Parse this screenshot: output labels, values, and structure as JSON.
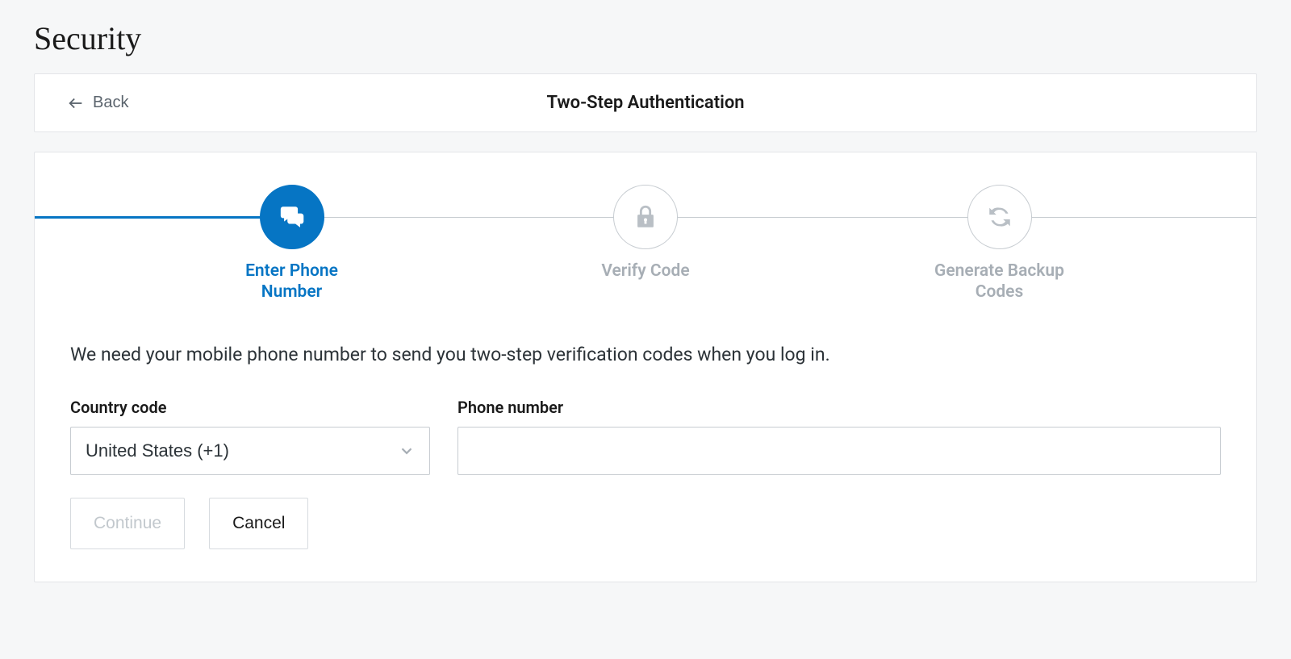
{
  "page": {
    "title": "Security"
  },
  "header": {
    "back_label": "Back",
    "title": "Two-Step Authentication"
  },
  "stepper": {
    "active_index": 0,
    "steps": [
      {
        "label": "Enter Phone Number"
      },
      {
        "label": "Verify Code"
      },
      {
        "label": "Generate Backup Codes"
      }
    ]
  },
  "form": {
    "description": "We need your mobile phone number to send you two-step verification codes when you log in.",
    "country_label": "Country code",
    "country_selected": "United States (+1)",
    "phone_label": "Phone number",
    "phone_value": ""
  },
  "actions": {
    "continue_label": "Continue",
    "continue_disabled": true,
    "cancel_label": "Cancel"
  }
}
